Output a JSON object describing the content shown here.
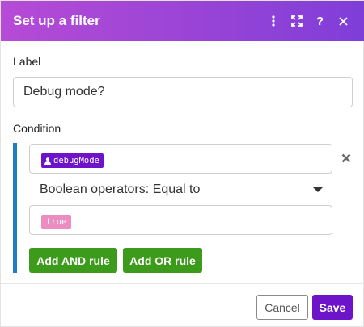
{
  "dialog": {
    "title": "Set up a filter",
    "header_icons": [
      "more-vertical-icon",
      "expand-icon",
      "help-icon",
      "close-icon"
    ],
    "header_icon_glyphs": {
      "help": "?"
    }
  },
  "form": {
    "label_caption": "Label",
    "label_value": "Debug mode?",
    "condition_caption": "Condition",
    "rule": {
      "operand1": {
        "icon": "user-icon",
        "text": "debugMode"
      },
      "operator": "Boolean operators: Equal to",
      "operand2": {
        "text": "true"
      }
    },
    "add_and_label": "Add AND rule",
    "add_or_label": "Add OR rule"
  },
  "footer": {
    "cancel_label": "Cancel",
    "save_label": "Save"
  },
  "colors": {
    "header_gradient": [
      "#b64bd6",
      "#7f3ed8"
    ],
    "variable_pill": "#6d13c9",
    "value_pill": "#ec8dc2",
    "condition_bar": "#1f7dc1",
    "add_rule_button": "#3d9b1b",
    "save_button": "#6d13c9"
  }
}
